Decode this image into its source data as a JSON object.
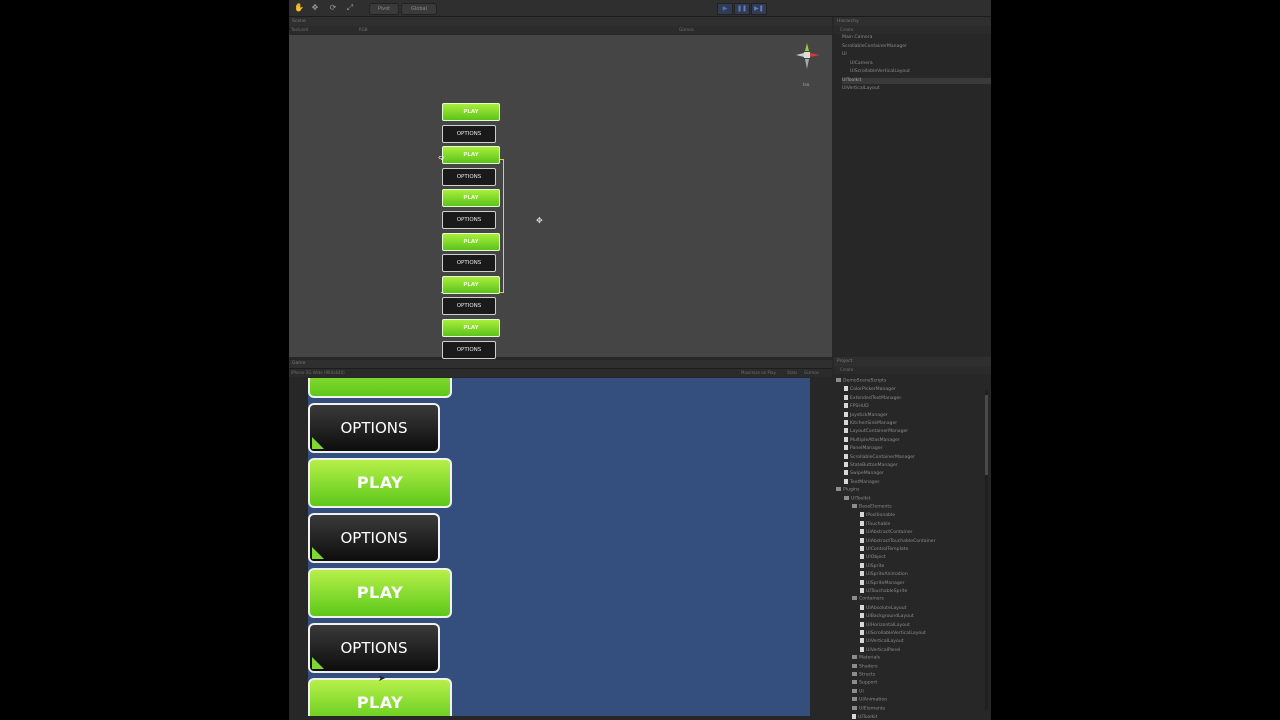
{
  "toolbar": {
    "pivot_label": "Pivot",
    "global_label": "Global",
    "tools": [
      "hand",
      "move",
      "rotate",
      "scale"
    ],
    "play_controls": [
      "play",
      "pause",
      "step"
    ]
  },
  "scene": {
    "tab": "Scene",
    "render_mode": "Textured",
    "color_mode": "RGB",
    "gizmos": "Gizmos",
    "persp_label": "Iso",
    "buttons": [
      "PLAY",
      "OPTIONS",
      "PLAY",
      "OPTIONS",
      "PLAY",
      "OPTIONS",
      "PLAY",
      "OPTIONS",
      "PLAY",
      "OPTIONS",
      "PLAY",
      "OPTIONS"
    ]
  },
  "game": {
    "tab": "Game",
    "resolution": "iPhone 5G Wide (960x640)",
    "maximize": "Maximize on Play",
    "stats": "Stats",
    "gizmos": "Gizmos",
    "buttons": [
      "PLAY",
      "OPTIONS",
      "PLAY",
      "OPTIONS",
      "PLAY",
      "OPTIONS",
      "PLAY"
    ]
  },
  "hierarchy": {
    "tab": "Hierarchy",
    "create": "Create",
    "items": [
      {
        "label": "Main Camera",
        "indent": 0
      },
      {
        "label": "ScrollableContainerManager",
        "indent": 0
      },
      {
        "label": "UI",
        "indent": 0
      },
      {
        "label": "UICamera",
        "indent": 1
      },
      {
        "label": "UIScrollableVerticalLayout",
        "indent": 1
      },
      {
        "label": "UIToolkit",
        "indent": 0,
        "selected": true
      },
      {
        "label": "UIVerticalLayout",
        "indent": 0
      }
    ]
  },
  "project": {
    "tab": "Project",
    "create": "Create",
    "items": [
      {
        "label": "DemoSceneScripts",
        "indent": 0,
        "type": "folder"
      },
      {
        "label": "ColorPickerManager",
        "indent": 1,
        "type": "script"
      },
      {
        "label": "ExtendedTextManager",
        "indent": 1,
        "type": "script"
      },
      {
        "label": "FPSHUD",
        "indent": 1,
        "type": "script"
      },
      {
        "label": "JoystickManager",
        "indent": 1,
        "type": "script"
      },
      {
        "label": "KitchenSinkManager",
        "indent": 1,
        "type": "script"
      },
      {
        "label": "LayoutContainerManager",
        "indent": 1,
        "type": "script"
      },
      {
        "label": "MultipleAtlasManager",
        "indent": 1,
        "type": "script"
      },
      {
        "label": "PanelManager",
        "indent": 1,
        "type": "script"
      },
      {
        "label": "ScrollableContainerManager",
        "indent": 1,
        "type": "script"
      },
      {
        "label": "StateButtonManager",
        "indent": 1,
        "type": "script"
      },
      {
        "label": "SwipeManager",
        "indent": 1,
        "type": "script"
      },
      {
        "label": "TextManager",
        "indent": 1,
        "type": "script"
      },
      {
        "label": "Plugins",
        "indent": 0,
        "type": "folder"
      },
      {
        "label": "UIToolkit",
        "indent": 1,
        "type": "folder"
      },
      {
        "label": "BaseElements",
        "indent": 2,
        "type": "folder"
      },
      {
        "label": "IPositionable",
        "indent": 3,
        "type": "script"
      },
      {
        "label": "ITouchable",
        "indent": 3,
        "type": "script"
      },
      {
        "label": "UIAbstractContainer",
        "indent": 3,
        "type": "script"
      },
      {
        "label": "UIAbstractTouchableContainer",
        "indent": 3,
        "type": "script"
      },
      {
        "label": "UIControlTemplate",
        "indent": 3,
        "type": "script"
      },
      {
        "label": "UIObject",
        "indent": 3,
        "type": "script"
      },
      {
        "label": "UISprite",
        "indent": 3,
        "type": "script"
      },
      {
        "label": "UISpriteAnimation",
        "indent": 3,
        "type": "script"
      },
      {
        "label": "UISpriteManager",
        "indent": 3,
        "type": "script"
      },
      {
        "label": "UITouchableSprite",
        "indent": 3,
        "type": "script"
      },
      {
        "label": "Containers",
        "indent": 2,
        "type": "folder"
      },
      {
        "label": "UIAbsoluteLayout",
        "indent": 3,
        "type": "script"
      },
      {
        "label": "UIBackgroundLayout",
        "indent": 3,
        "type": "script"
      },
      {
        "label": "UIHorizontalLayout",
        "indent": 3,
        "type": "script"
      },
      {
        "label": "UIScrollableVerticalLayout",
        "indent": 3,
        "type": "script"
      },
      {
        "label": "UIVerticalLayout",
        "indent": 3,
        "type": "script"
      },
      {
        "label": "UIVerticalPanel",
        "indent": 3,
        "type": "script"
      },
      {
        "label": "Materials",
        "indent": 2,
        "type": "folder"
      },
      {
        "label": "Shaders",
        "indent": 2,
        "type": "folder"
      },
      {
        "label": "Structs",
        "indent": 2,
        "type": "folder"
      },
      {
        "label": "Support",
        "indent": 2,
        "type": "folder"
      },
      {
        "label": "UI",
        "indent": 2,
        "type": "folder"
      },
      {
        "label": "UIAnimation",
        "indent": 2,
        "type": "folder"
      },
      {
        "label": "UIElements",
        "indent": 2,
        "type": "folder"
      },
      {
        "label": "UIToolkit",
        "indent": 2,
        "type": "script"
      }
    ]
  }
}
